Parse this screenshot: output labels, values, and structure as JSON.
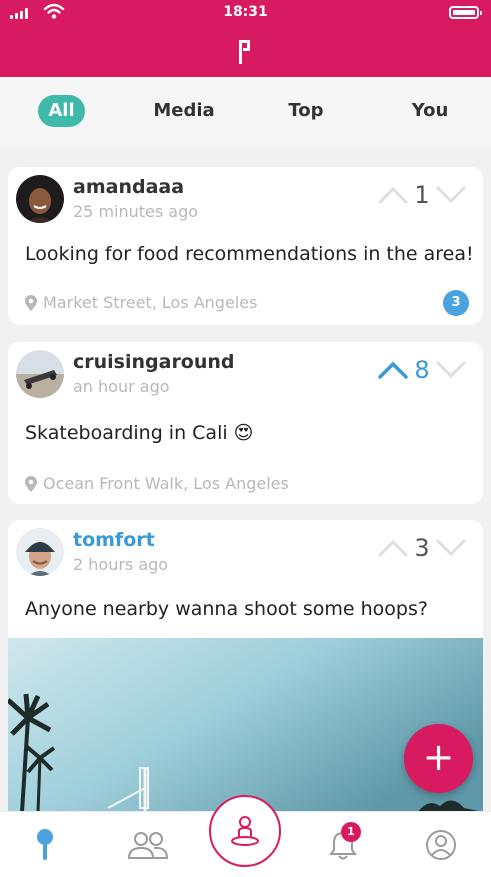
{
  "status_bar": {
    "time": "18:31"
  },
  "tabs": [
    {
      "label": "All",
      "active": true
    },
    {
      "label": "Media",
      "active": false
    },
    {
      "label": "Top",
      "active": false
    },
    {
      "label": "You",
      "active": false
    }
  ],
  "posts": [
    {
      "username": "amandaaa",
      "time_ago": "25 minutes ago",
      "votes": "1",
      "upvoted": false,
      "text": "Looking for food recommendations in the area!",
      "location": "Market Street, Los Angeles",
      "comment_count": "3"
    },
    {
      "username": "cruisingaround",
      "time_ago": "an hour ago",
      "votes": "8",
      "upvoted": true,
      "text": "Skateboarding in Cali 😍",
      "location": "Ocean Front Walk, Los Angeles"
    },
    {
      "username": "tomfort",
      "time_ago": "2 hours ago",
      "votes": "3",
      "upvoted": false,
      "text": "Anyone nearby wanna shoot some hoops?"
    }
  ],
  "fab": {
    "label": "+"
  },
  "bottom_nav": {
    "items": [
      "location-pin-icon",
      "people-icon",
      "person-on-spot-icon",
      "bell-icon",
      "profile-icon"
    ],
    "notification_badge": "1"
  },
  "colors": {
    "brand": "#d81b60",
    "active_tab": "#3fb9a9",
    "link_blue": "#3a9ad9"
  }
}
